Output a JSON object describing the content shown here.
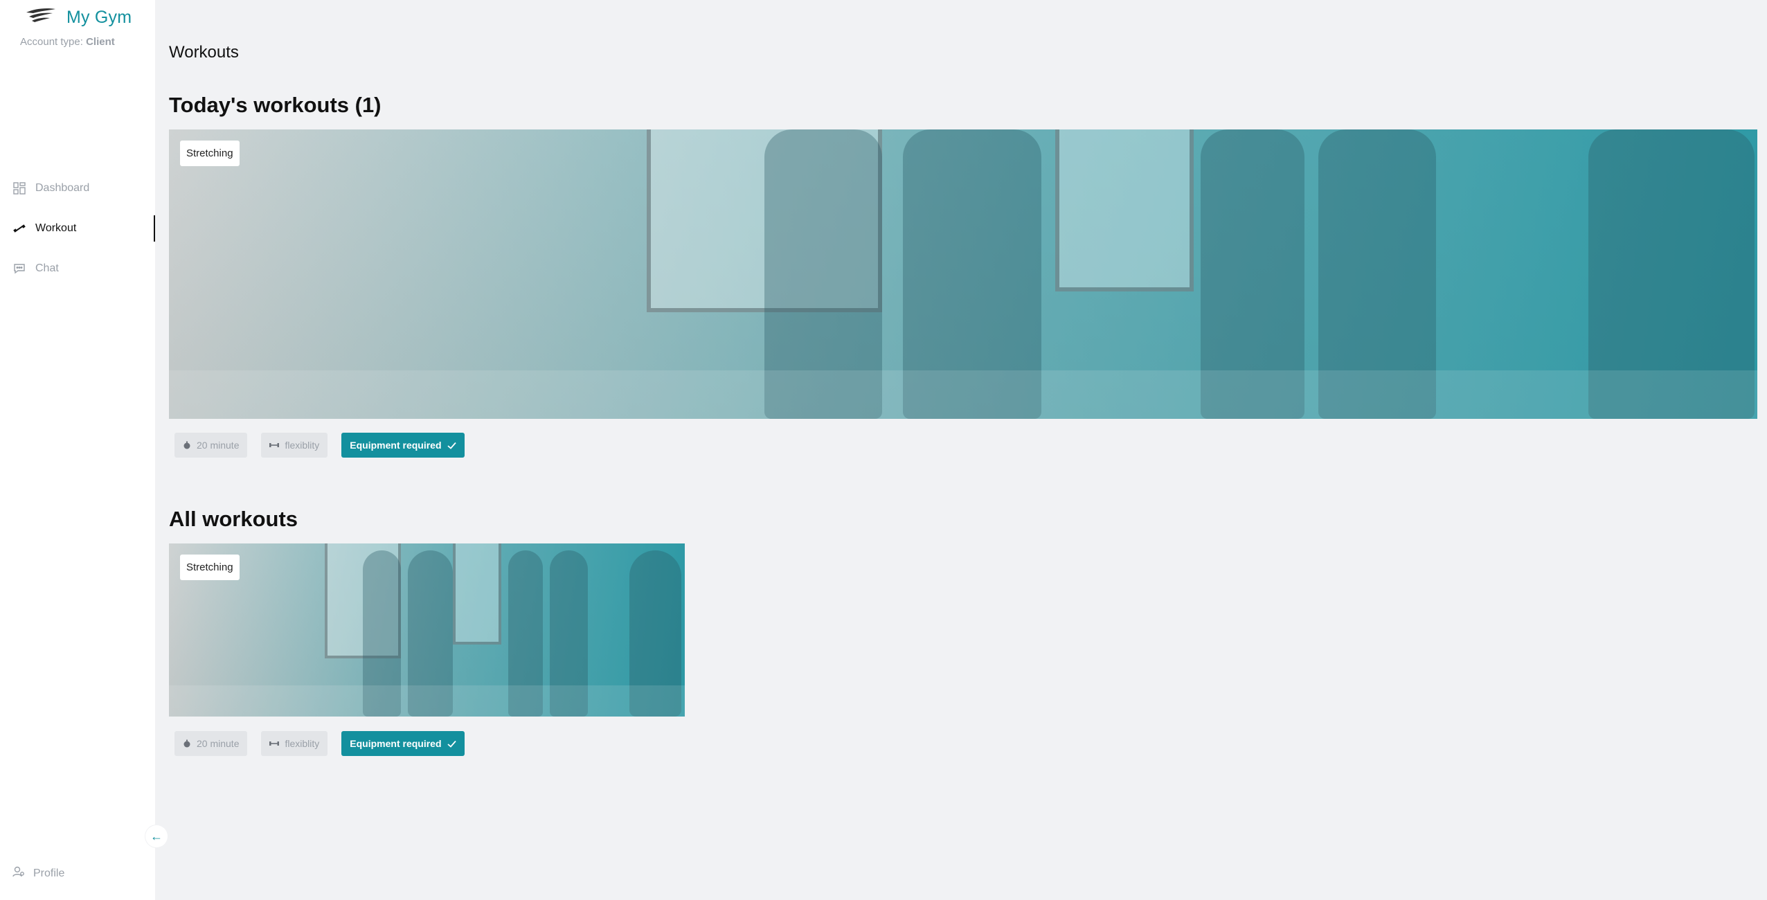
{
  "brand": {
    "name": "My Gym"
  },
  "account": {
    "prefix": "Account type:",
    "type": "Client"
  },
  "nav": {
    "items": [
      {
        "label": "Dashboard",
        "icon": "dashboard-icon"
      },
      {
        "label": "Workout",
        "icon": "workout-icon"
      },
      {
        "label": "Chat",
        "icon": "chat-icon"
      }
    ],
    "active": "Workout"
  },
  "profile": {
    "label": "Profile",
    "icon": "profile-icon"
  },
  "collapse": {
    "icon": "arrow-left-icon",
    "glyph": "←"
  },
  "page": {
    "title": "Workouts"
  },
  "today": {
    "heading": "Today's workouts (1)",
    "card": {
      "tag": "Stretching",
      "chips": {
        "duration": "20 minute",
        "category": "flexiblity",
        "equipment": "Equipment required"
      }
    }
  },
  "all": {
    "heading": "All workouts",
    "card": {
      "tag": "Stretching",
      "chips": {
        "duration": "20 minute",
        "category": "flexiblity",
        "equipment": "Equipment required"
      }
    }
  },
  "colors": {
    "accent": "#13909e",
    "background": "#f1f2f4",
    "muted": "#9aa0a8"
  }
}
